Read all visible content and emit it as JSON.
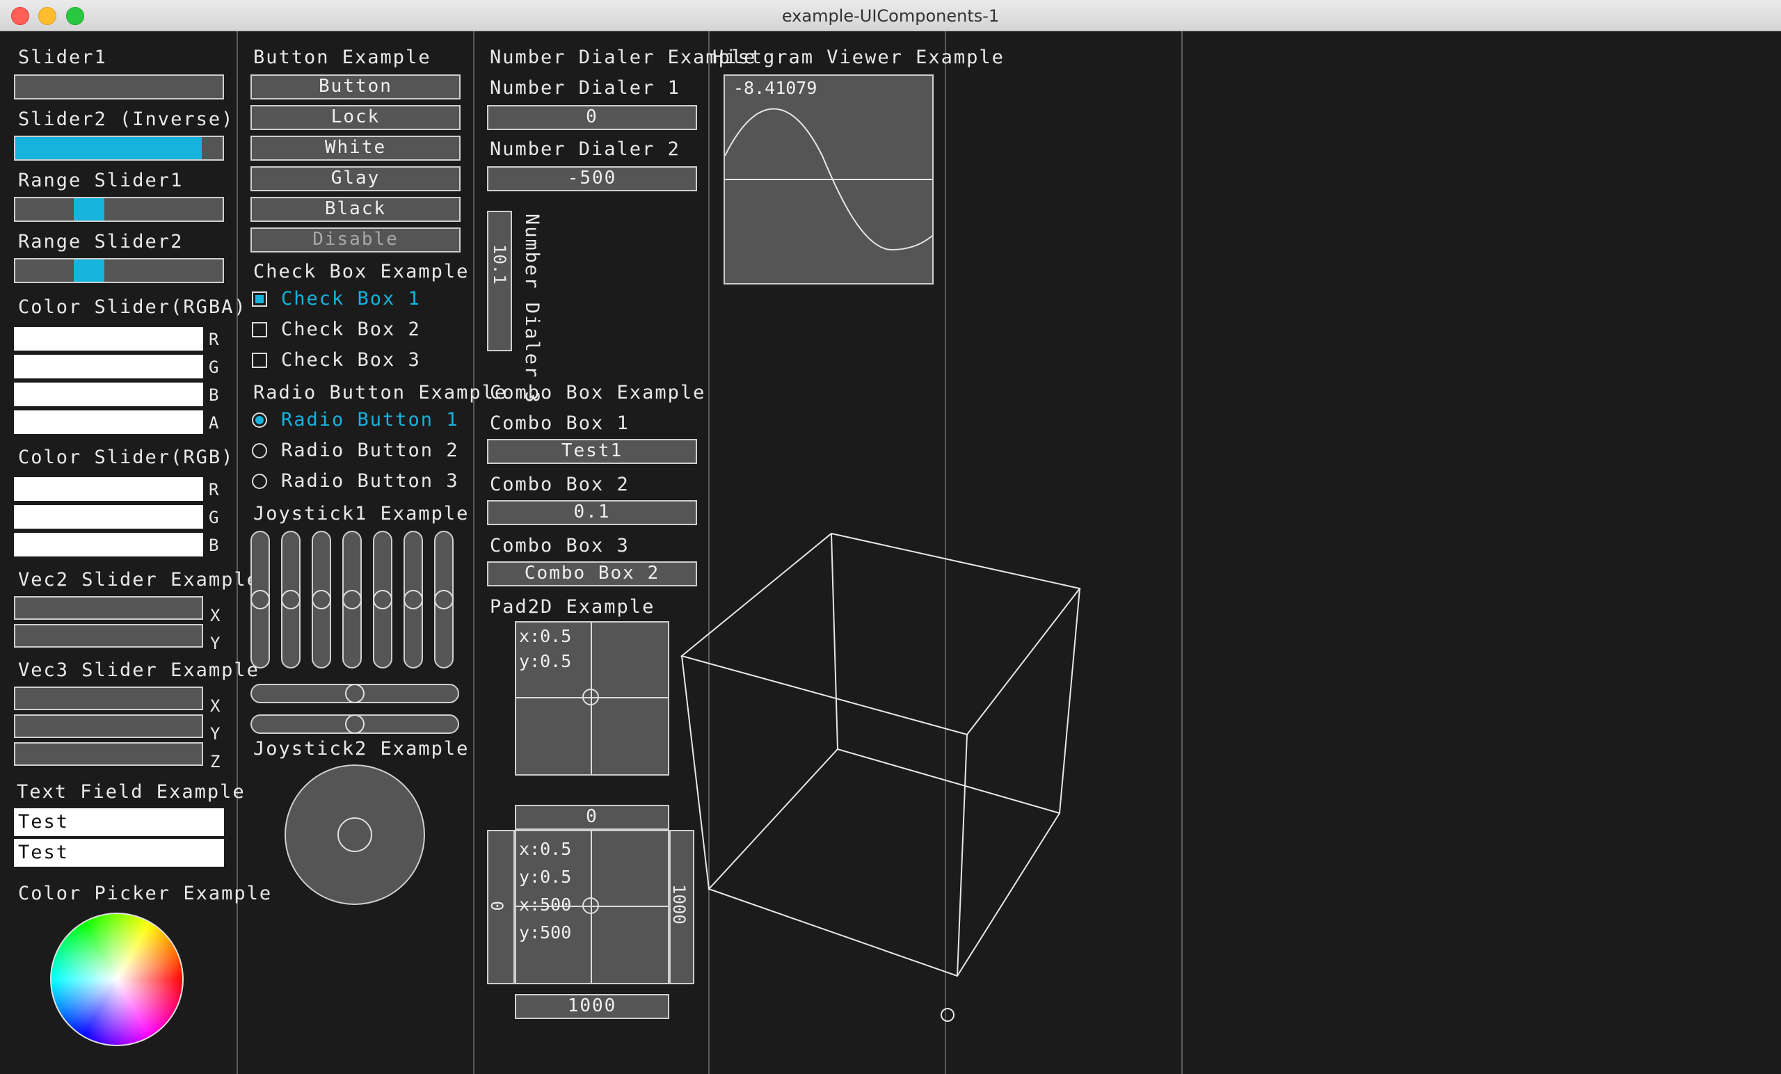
{
  "window": {
    "title": "example-UIComponents-1"
  },
  "sliders": {
    "slider1": "Slider1",
    "slider2": "Slider2 (Inverse)",
    "slider2_value": 0.9,
    "range1": "Range Slider1",
    "range2": "Range Slider2",
    "color_rgba": "Color Slider(RGBA)",
    "color_rgb": "Color Slider(RGB)",
    "vec2": "Vec2 Slider Example",
    "vec3": "Vec3 Slider Example",
    "axis": {
      "r": "R",
      "g": "G",
      "b": "B",
      "a": "A",
      "x": "X",
      "y": "Y",
      "z": "Z"
    }
  },
  "textfield": {
    "label": "Text Field Example",
    "value1": "Test",
    "value2": "Test"
  },
  "colorpicker": {
    "label": "Color Picker Example"
  },
  "buttons": {
    "label": "Button Example",
    "items": [
      "Button",
      "Lock",
      "White",
      "Glay",
      "Black",
      "Disable"
    ]
  },
  "checkboxes": {
    "label": "Check Box Example",
    "items": [
      "Check Box 1",
      "Check Box 2",
      "Check Box 3"
    ],
    "checked_index": 0
  },
  "radios": {
    "label": "Radio Button Example",
    "items": [
      "Radio Button 1",
      "Radio Button 2",
      "Radio Button 3"
    ],
    "selected_index": 0
  },
  "joystick1": {
    "label": "Joystick1 Example"
  },
  "joystick2": {
    "label": "Joystick2 Example"
  },
  "dialers": {
    "label": "Number Dialer Example",
    "d1_label": "Number Dialer 1",
    "d1_value": "0",
    "d2_label": "Number Dialer 2",
    "d2_value": "-500",
    "d3_label": "Number Dialer 3",
    "d3_value": "10.1"
  },
  "combos": {
    "label": "Combo Box Example",
    "c1_label": "Combo Box 1",
    "c1_value": "Test1",
    "c2_label": "Combo Box 2",
    "c2_value": "0.1",
    "c3_label": "Combo Box 3",
    "c3_value": "Combo Box 2"
  },
  "pad2d": {
    "label": "Pad2D Example",
    "p1_x": "x:0.5",
    "p1_y": "y:0.5",
    "p2_x": "x:0.5",
    "p2_y": "y:0.5",
    "p2_x2": "x:500",
    "p2_y2": "y:500",
    "top": "0",
    "bottom": "1000",
    "left": "0",
    "right": "1000"
  },
  "histogram": {
    "label": "Histgram Viewer Example",
    "value": "-8.41079"
  },
  "colors": {
    "accent": "#16b3dc",
    "background": "#1b1b1b",
    "widget": "#555555"
  }
}
